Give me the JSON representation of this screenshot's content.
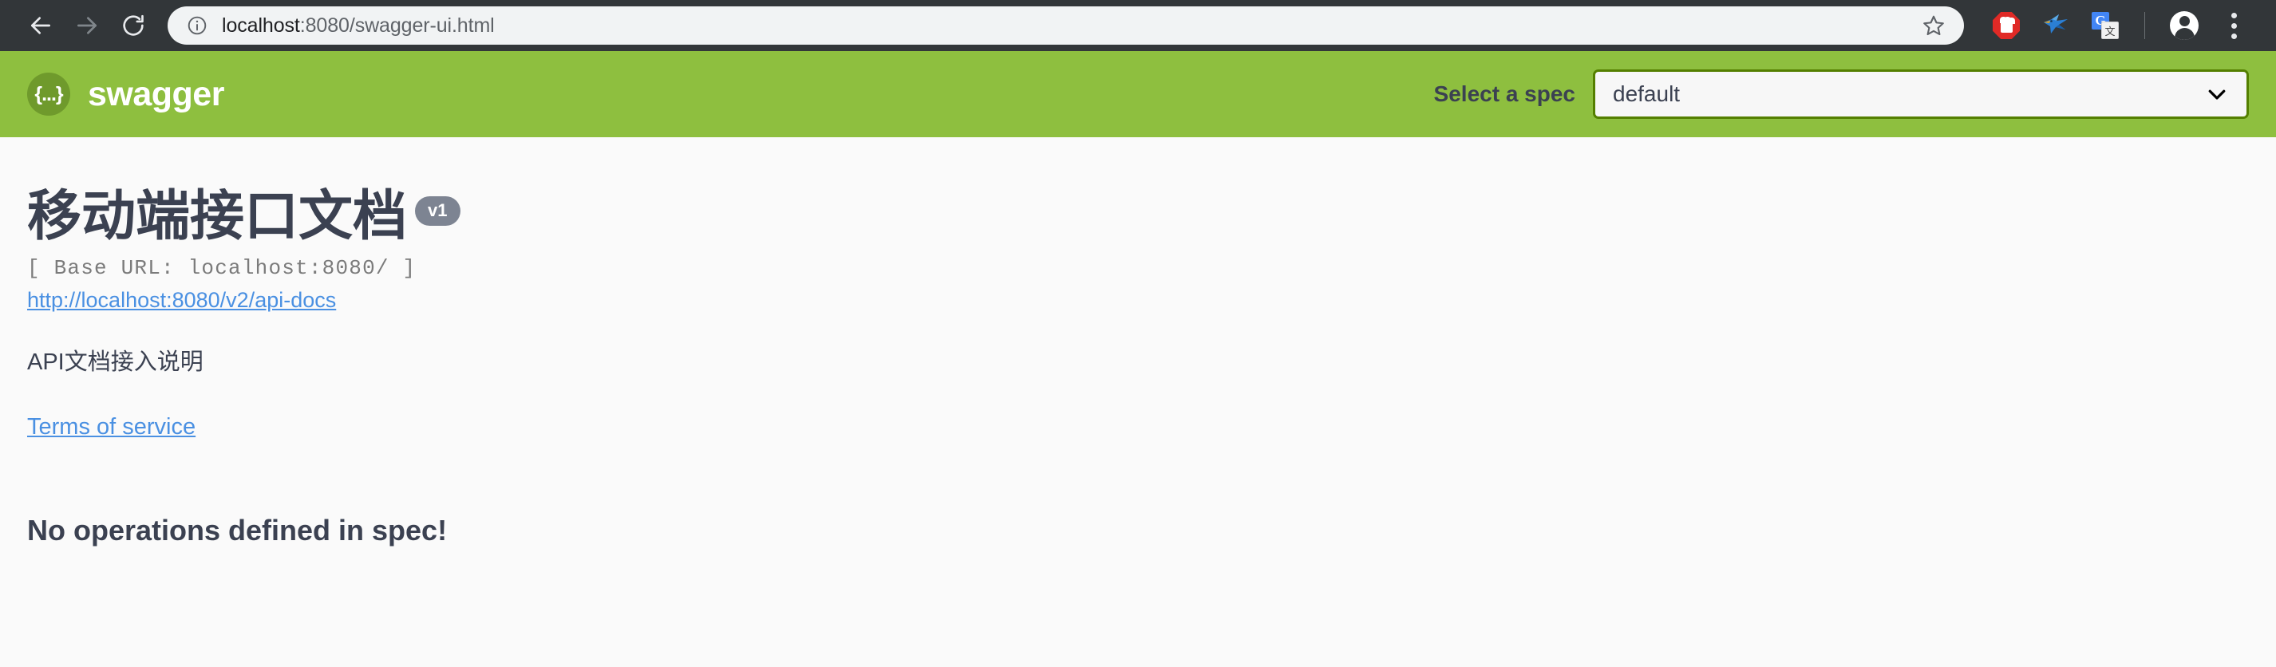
{
  "browser": {
    "nav": {
      "back_icon": "arrow-left-icon",
      "forward_icon": "arrow-right-icon",
      "reload_icon": "reload-icon"
    },
    "omnibox": {
      "info_icon": "info-circle-icon",
      "url_host": "localhost",
      "url_rest": ":8080/swagger-ui.html",
      "star_icon": "bookmark-star-icon"
    },
    "extensions": [
      {
        "name": "adblock-extension-icon",
        "label": "AdBlock"
      },
      {
        "name": "bird-extension-icon",
        "label": "Bird"
      },
      {
        "name": "google-translate-icon",
        "label": "Translate",
        "g": "G",
        "cjk": "文"
      }
    ],
    "profile_icon": "profile-avatar-icon",
    "menu_icon": "three-dot-menu-icon"
  },
  "topbar": {
    "logo_mark": "{...}",
    "brand_name": "swagger",
    "spec_label": "Select a spec",
    "spec_selected": "default",
    "spec_options": [
      "default"
    ],
    "chevron_icon": "chevron-down-icon"
  },
  "content": {
    "title": "移动端接口文档",
    "version_badge": "v1",
    "base_url": "[ Base URL: localhost:8080/ ]",
    "docs_link": "http://localhost:8080/v2/api-docs",
    "description": "API文档接入说明",
    "terms_link": "Terms of service",
    "no_operations": "No operations defined in spec!"
  },
  "colors": {
    "swagger_green": "#8ebf3f",
    "logo_green": "#6f9a2c",
    "select_border": "#547f00",
    "text_navy": "#3b4151",
    "link_blue": "#4a90e2",
    "badge_gray": "#7d8492",
    "toolbar_dark": "#323639",
    "page_bg": "#fafafa"
  }
}
